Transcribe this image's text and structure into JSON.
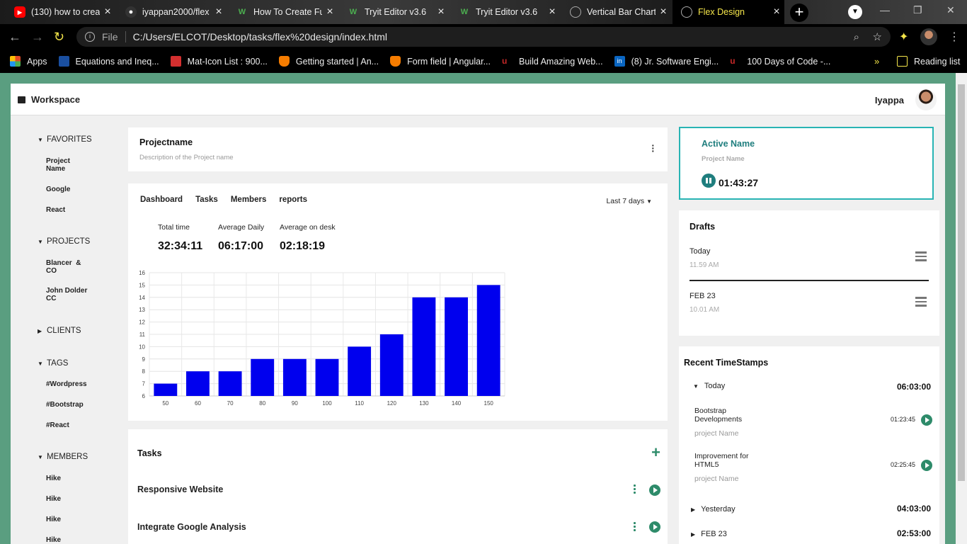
{
  "browser": {
    "tabs": [
      {
        "label": "(130) how to crea",
        "icon": "youtube-icon"
      },
      {
        "label": "iyappan2000/flex",
        "icon": "github-icon"
      },
      {
        "label": "How To Create Fu",
        "icon": "w3schools-icon"
      },
      {
        "label": "Tryit Editor v3.6",
        "icon": "w3schools-icon"
      },
      {
        "label": "Tryit Editor v3.6",
        "icon": "w3schools-icon"
      },
      {
        "label": "Vertical Bar Chart",
        "icon": "globe-icon"
      },
      {
        "label": "Flex Design",
        "icon": "globe-icon",
        "active": true
      }
    ],
    "scheme": "File",
    "url": "C:/Users/ELCOT/Desktop/tasks/flex%20design/index.html",
    "bookmarks": [
      {
        "label": "Apps",
        "color": "#e34c26"
      },
      {
        "label": "Equations and Ineq...",
        "color": "#1a4fa0"
      },
      {
        "label": "Mat-Icon List : 900...",
        "color": "#d32f2f"
      },
      {
        "label": "Getting started | An...",
        "color": "#f57c00"
      },
      {
        "label": "Form field | Angular...",
        "color": "#f57c00"
      },
      {
        "label": "Build Amazing Web...",
        "color": "#c62828"
      },
      {
        "label": "(8) Jr. Software Engi...",
        "color": "#0a66c2"
      },
      {
        "label": "100 Days of Code -...",
        "color": "#c62828"
      }
    ],
    "reading_list": "Reading list",
    "more": "»"
  },
  "app": {
    "brand": "Workspace",
    "user": "Iyappa"
  },
  "sidebar": {
    "favorites": {
      "title": "FAVORITES",
      "items": [
        "Project Name",
        "Google",
        "React"
      ]
    },
    "projects": {
      "title": "PROJECTS",
      "items": [
        "Blancer  & CO",
        "John Dolder  CC"
      ]
    },
    "clients": {
      "title": "CLIENTS"
    },
    "tags": {
      "title": "TAGS",
      "items": [
        "#Wordpress",
        "#Bootstrap",
        "#React"
      ]
    },
    "members": {
      "title": "MEMBERS",
      "items": [
        "Hike",
        "Hike",
        "Hike",
        "Hike"
      ]
    }
  },
  "project": {
    "title": "Projectname",
    "description": "Description of the Project name"
  },
  "dashboard": {
    "tabs": [
      "Dashboard",
      "Tasks",
      "Members",
      "reports"
    ],
    "range": "Last 7 days",
    "stats": [
      {
        "label": "Total time",
        "value": "32:34:11"
      },
      {
        "label": "Average Daily",
        "value": "06:17:00"
      },
      {
        "label": "Average on desk",
        "value": "02:18:19"
      }
    ]
  },
  "chart_data": {
    "type": "bar",
    "categories": [
      "50",
      "60",
      "70",
      "80",
      "90",
      "100",
      "110",
      "120",
      "130",
      "140",
      "150"
    ],
    "values": [
      7,
      8,
      8,
      9,
      9,
      9,
      10,
      11,
      14,
      14,
      15
    ],
    "ylim": [
      6,
      16
    ],
    "yticks": [
      6,
      7,
      8,
      9,
      10,
      11,
      12,
      13,
      14,
      15,
      16
    ],
    "bar_color": "#0000ee",
    "grid": true
  },
  "tasks": {
    "title": "Tasks",
    "add": "+",
    "items": [
      "Responsive Website",
      "Integrate Google Analysis"
    ]
  },
  "active": {
    "name": "Active Name",
    "project": "Project Name",
    "time": "01:43:27"
  },
  "drafts": {
    "title": "Drafts",
    "items": [
      {
        "day": "Today",
        "time": "11.59 AM"
      },
      {
        "day": "FEB 23",
        "time": "10.01 AM"
      }
    ]
  },
  "recent": {
    "title": "Recent TimeStamps",
    "groups": [
      {
        "label": "Today",
        "total": "06:03:00"
      },
      {
        "label": "Yesterday",
        "total": "04:03:00"
      },
      {
        "label": "FEB 23",
        "total": "02:53:00"
      }
    ],
    "entries": [
      {
        "title": "Bootstrap Developments",
        "project": "project Name",
        "time": "01:23:45"
      },
      {
        "title": "Improvement for HTML5",
        "project": "project Name",
        "time": "02:25:45"
      }
    ]
  },
  "colors": {
    "accent": "#2e8b6a",
    "teal": "#1f7e7e",
    "page_bg": "#5a9e80"
  }
}
